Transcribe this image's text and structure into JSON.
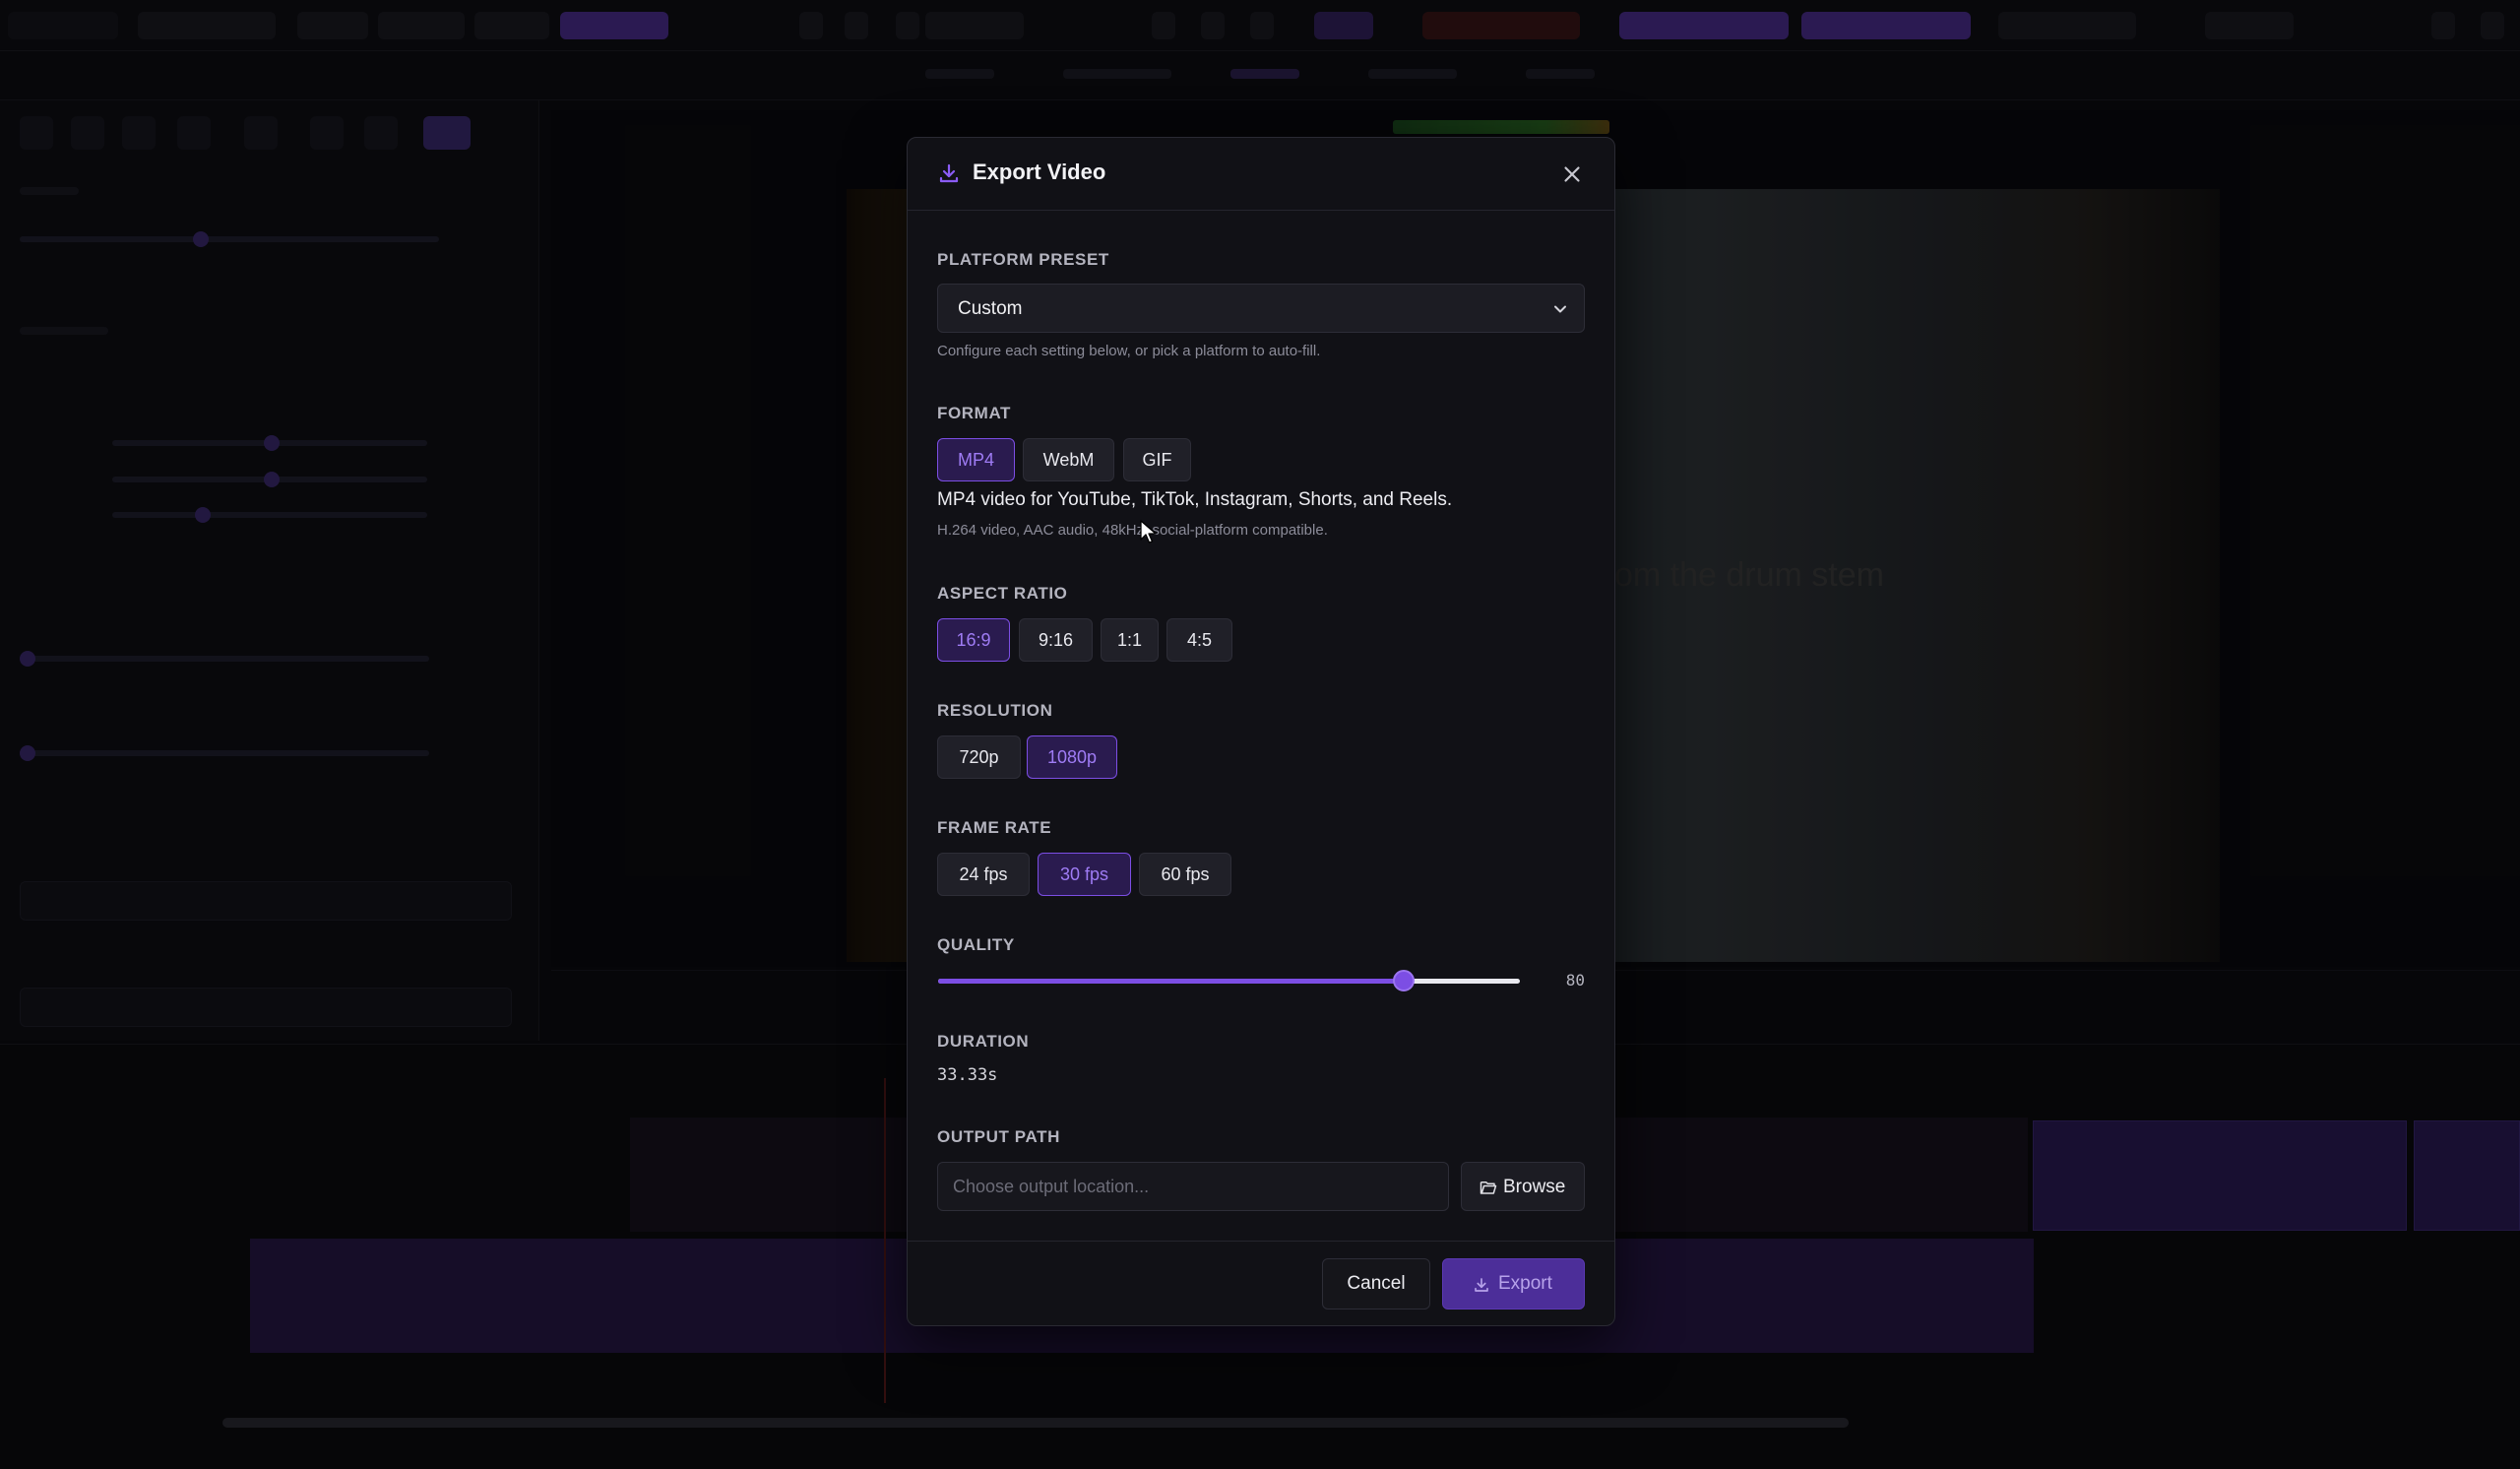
{
  "background": {
    "video_caption_ghost": "om the drum stem"
  },
  "dialog": {
    "title": "Export Video",
    "platform_preset": {
      "label": "PLATFORM PRESET",
      "selected": "Custom",
      "hint": "Configure each setting below, or pick a platform to auto-fill."
    },
    "format": {
      "label": "FORMAT",
      "options": [
        "MP4",
        "WebM",
        "GIF"
      ],
      "selected": "MP4",
      "description": "MP4 video for YouTube, TikTok, Instagram, Shorts, and Reels.",
      "details": "H.264 video, AAC audio, 48kHz, social-platform compatible."
    },
    "aspect_ratio": {
      "label": "ASPECT RATIO",
      "options": [
        "16:9",
        "9:16",
        "1:1",
        "4:5"
      ],
      "selected": "16:9"
    },
    "resolution": {
      "label": "RESOLUTION",
      "options": [
        "720p",
        "1080p"
      ],
      "selected": "1080p"
    },
    "frame_rate": {
      "label": "FRAME RATE",
      "options": [
        "24 fps",
        "30 fps",
        "60 fps"
      ],
      "selected": "30 fps"
    },
    "quality": {
      "label": "QUALITY",
      "value": 80,
      "value_text": "80",
      "min": 0,
      "max": 100
    },
    "duration": {
      "label": "DURATION",
      "value": "33.33s"
    },
    "output_path": {
      "label": "OUTPUT PATH",
      "value": "",
      "placeholder": "Choose output location...",
      "browse_label": "Browse"
    },
    "footer": {
      "cancel_label": "Cancel",
      "export_label": "Export"
    }
  },
  "colors": {
    "accent": "#7c4ee4",
    "accent_text": "#9f7cf5",
    "modal_bg": "#111116"
  },
  "icons": {
    "title": "download-icon",
    "close": "close-icon",
    "select": "chevron-down-icon",
    "browse": "folder-open-icon",
    "export": "download-icon"
  }
}
